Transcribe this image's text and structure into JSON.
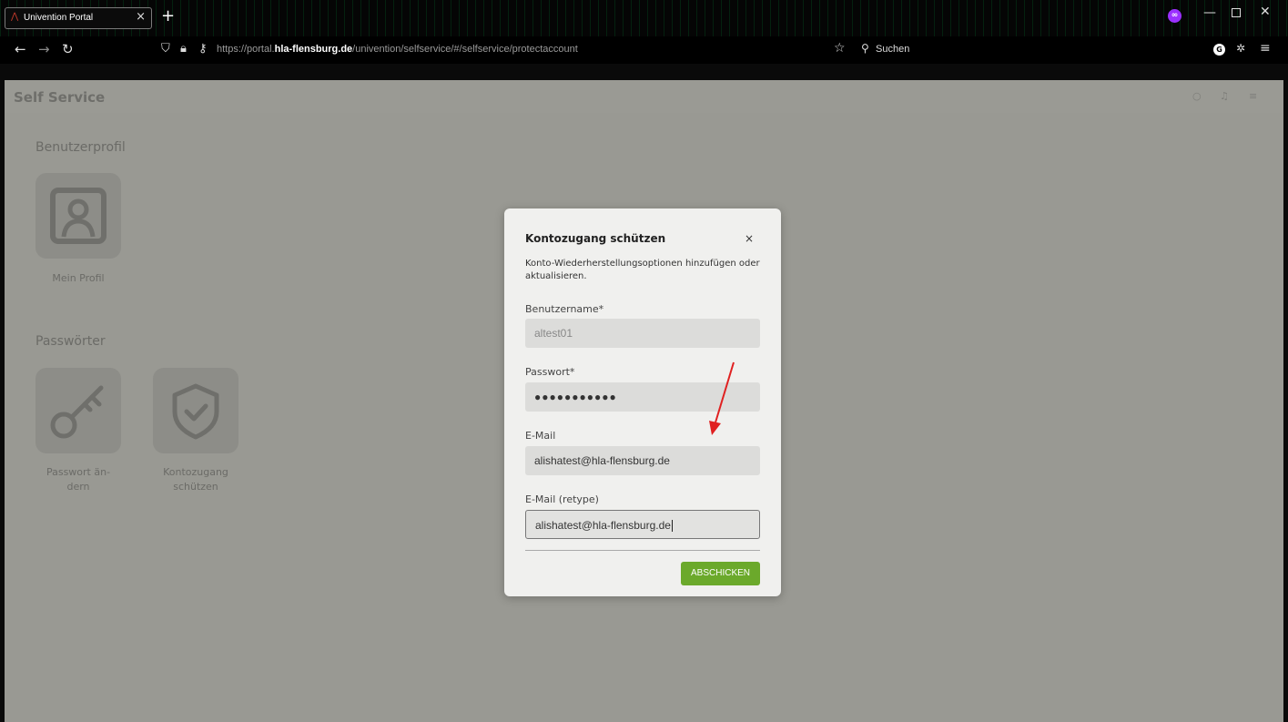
{
  "browser": {
    "tab_title": "Univention Portal",
    "tab_close": "×",
    "new_tab": "+",
    "url_prefix": "https://portal.",
    "url_domain": "hla-flensburg.de",
    "url_path": "/univention/selfservice/#/selfservice/protectaccount",
    "search_placeholder": "Suchen",
    "account_initial": "G",
    "extension_glyph": "∞"
  },
  "page": {
    "app_title": "Self Service",
    "sections": [
      {
        "title": "Benutzerprofil",
        "tiles": [
          {
            "label": "Mein Profil",
            "icon": "user-portrait-icon"
          }
        ]
      },
      {
        "title": "Passwörter",
        "tiles": [
          {
            "label_lines": [
              "Passwort än-",
              "dern"
            ],
            "icon": "key-icon"
          },
          {
            "label_lines": [
              "Kontozugang",
              "schützen"
            ],
            "icon": "shield-check-icon"
          }
        ]
      }
    ]
  },
  "modal": {
    "title": "Kontozugang schützen",
    "close": "×",
    "description": "Konto-Wiederherstellungsoptionen hinzufügen oder aktualisieren.",
    "fields": {
      "username": {
        "label": "Benutzername*",
        "value": "altest01"
      },
      "password": {
        "label": "Passwort*",
        "value": "●●●●●●●●●●●"
      },
      "email": {
        "label": "E-Mail",
        "value": "alishatest@hla-flensburg.de"
      },
      "email_retype": {
        "label": "E-Mail (retype)",
        "value": "alishatest@hla-flensburg.de"
      }
    },
    "submit_label": "ABSCHICKEN"
  },
  "colors": {
    "accent": "#6ba92b",
    "annotation": "#e02020",
    "overlay": "#999993"
  }
}
